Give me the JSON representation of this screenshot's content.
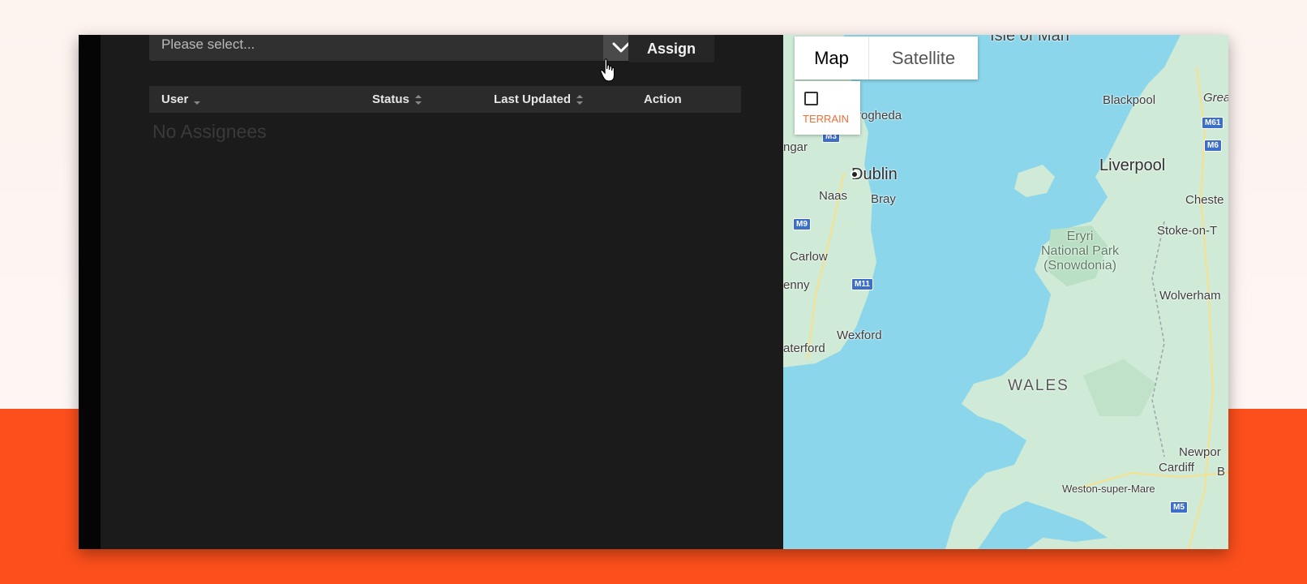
{
  "assign_panel": {
    "select_placeholder": "Please select...",
    "assign_label": "Assign",
    "table": {
      "columns": [
        "User",
        "Status",
        "Last Updated",
        "Action"
      ],
      "empty_text": "No Assignees"
    }
  },
  "map": {
    "type_controls": {
      "map_label": "Map",
      "satellite_label": "Satellite",
      "selected": "Map"
    },
    "terrain_label": "TERRAIN",
    "labels": {
      "isle_of_man": "Isle of Man",
      "drogheda": "rogheda",
      "ngar": "ngar",
      "dublin": "Dublin",
      "naas": "Naas",
      "bray": "Bray",
      "carlow": "Carlow",
      "enny": "enny",
      "wexford": "Wexford",
      "waterford": "aterford",
      "blackpool": "Blackpool",
      "great": "Great",
      "liverpool": "Liverpool",
      "chester": "Cheste",
      "stoke": "Stoke-on-T",
      "park": "Eryri\nNational Park\n(Snowdonia)",
      "wolverhampton": "Wolverham",
      "wales": "WALES",
      "newport": "Newpor",
      "cardiff": "Cardiff",
      "b": "B",
      "weston": "Weston-super-Mare"
    },
    "shields": {
      "m3": "M3",
      "m9": "M9",
      "m11": "M11",
      "m61": "M61",
      "m6": "M6",
      "m5": "M5"
    }
  },
  "colors": {
    "accent_orange": "#fc4f1c",
    "panel_bg": "#1b1b1b",
    "water": "#8bd6ea",
    "land": "#cfead7"
  }
}
